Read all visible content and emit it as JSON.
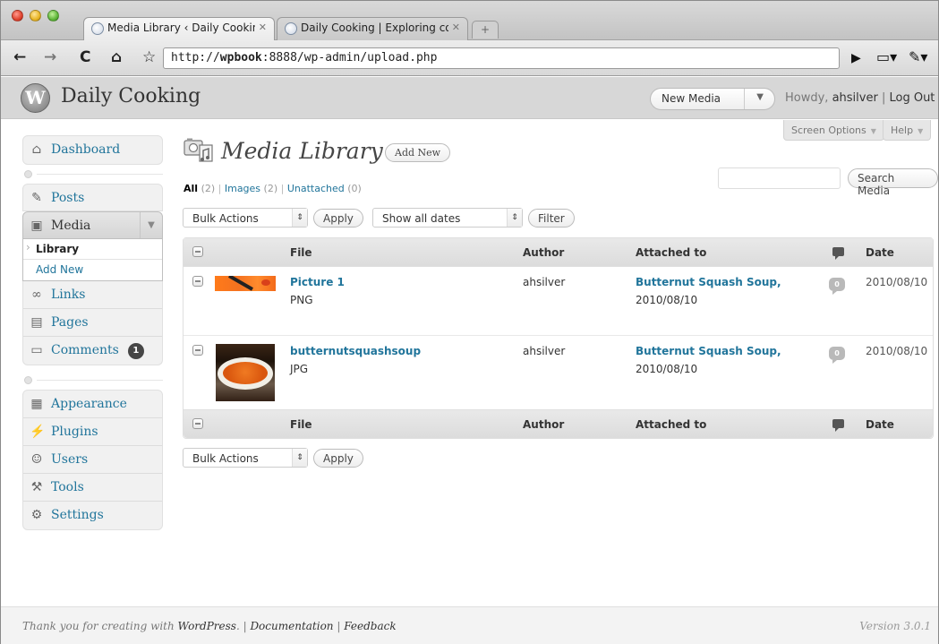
{
  "browser": {
    "tabs": [
      {
        "title": "Media Library ‹ Daily Cookin",
        "close": "✕"
      },
      {
        "title": "Daily Cooking | Exploring co",
        "close": "✕"
      }
    ],
    "new_tab": "+",
    "url_prefix": "http://",
    "url_host": "wpbook",
    "url_rest": ":8888/wp-admin/upload.php"
  },
  "header": {
    "logo_letter": "W",
    "site_title": "Daily Cooking",
    "new_media_label": "New Media",
    "howdy_prefix": "Howdy, ",
    "username": "ahsilver",
    "separator": " | ",
    "logout": "Log Out"
  },
  "screen_tabs": {
    "screen_options": "Screen Options",
    "help": "Help"
  },
  "sidebar": {
    "dashboard": "Dashboard",
    "posts": "Posts",
    "media": "Media",
    "media_sub": [
      "Library",
      "Add New"
    ],
    "links": "Links",
    "pages": "Pages",
    "comments": "Comments",
    "comments_count": "1",
    "appearance": "Appearance",
    "plugins": "Plugins",
    "users": "Users",
    "tools": "Tools",
    "settings": "Settings"
  },
  "main": {
    "title": "Media Library",
    "add_new": "Add New",
    "filters": {
      "all": "All",
      "all_count": "(2)",
      "images": "Images",
      "images_count": "(2)",
      "unattached": "Unattached",
      "unattached_count": "(0)",
      "sep": " | "
    },
    "search_button": "Search Media",
    "bulk_actions": "Bulk Actions",
    "apply": "Apply",
    "show_all_dates": "Show all dates",
    "filter": "Filter",
    "columns": {
      "file": "File",
      "author": "Author",
      "attached_to": "Attached to",
      "date": "Date"
    },
    "rows": [
      {
        "file": "Picture 1",
        "type": "PNG",
        "author": "ahsilver",
        "attached_title": "Butternut Squash Soup,",
        "attached_date": "2010/08/10",
        "comments": "0",
        "date": "2010/08/10"
      },
      {
        "file": "butternutsquashsoup",
        "type": "JPG",
        "author": "ahsilver",
        "attached_title": "Butternut Squash Soup,",
        "attached_date": "2010/08/10",
        "comments": "0",
        "date": "2010/08/10"
      }
    ]
  },
  "footer": {
    "thanks": "Thank you for creating with ",
    "wordpress": "WordPress",
    "dot": ". | ",
    "documentation": "Documentation",
    "pipe": " | ",
    "feedback": "Feedback",
    "version": "Version 3.0.1"
  }
}
